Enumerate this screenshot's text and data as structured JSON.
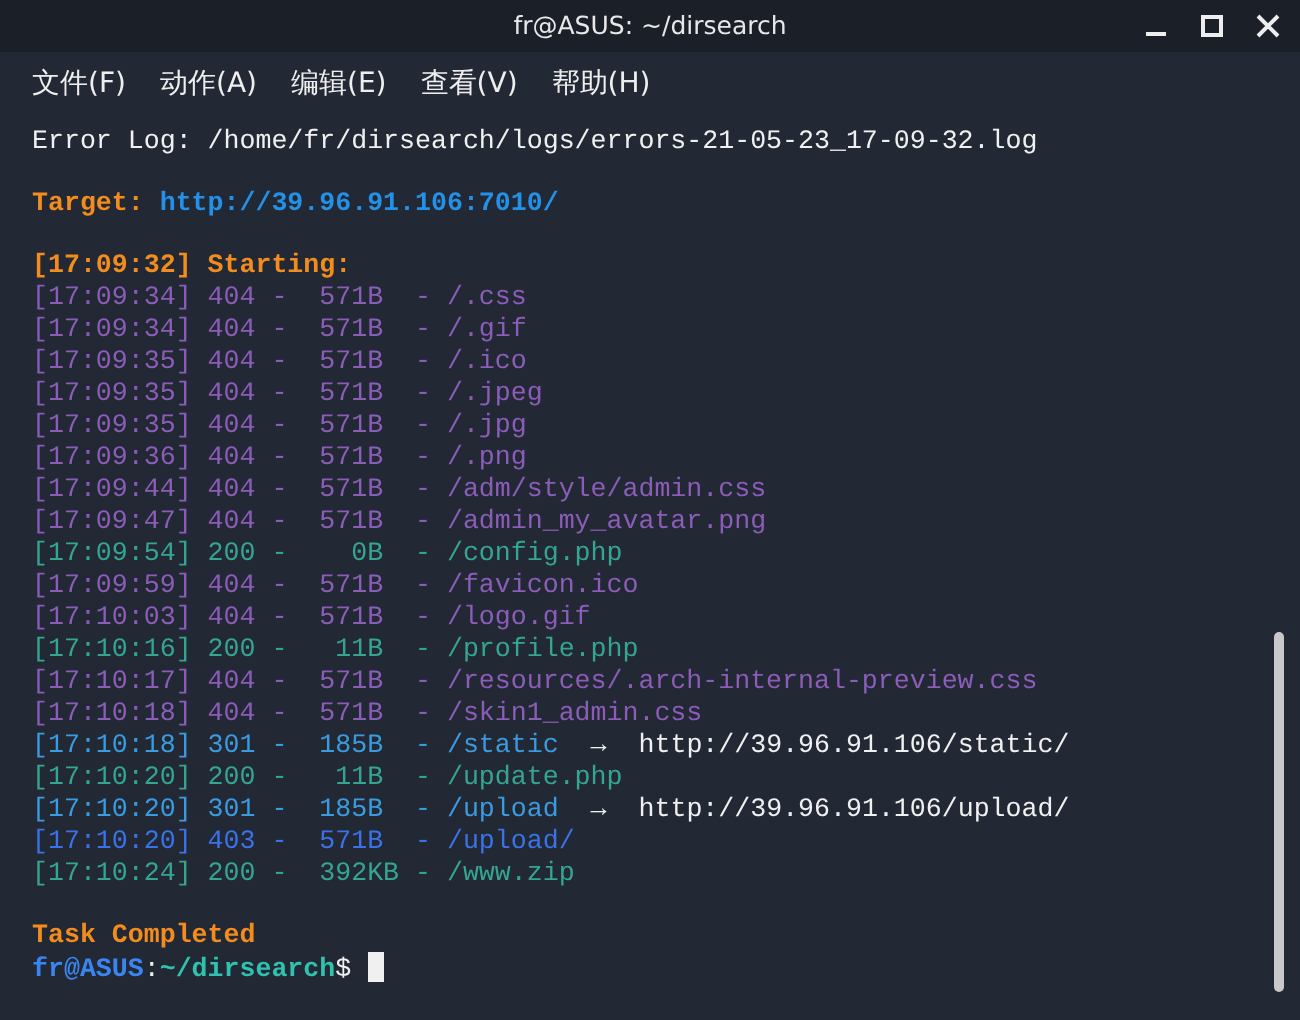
{
  "window": {
    "title": "fr@ASUS: ~/dirsearch"
  },
  "menu": [
    "文件(F)",
    "动作(A)",
    "编辑(E)",
    "查看(V)",
    "帮助(H)"
  ],
  "terminal": {
    "error_log": "Error Log: /home/fr/dirsearch/logs/errors-21-05-23_17-09-32.log",
    "target": {
      "label": "Target:",
      "url": "http://39.96.91.106:7010/"
    },
    "starting": "[17:09:32] Starting:",
    "rows": [
      {
        "text": "[17:09:34] 404 -  571B  - /.css",
        "color": "#8b5cb8"
      },
      {
        "text": "[17:09:34] 404 -  571B  - /.gif",
        "color": "#8b5cb8"
      },
      {
        "text": "[17:09:35] 404 -  571B  - /.ico",
        "color": "#8b5cb8"
      },
      {
        "text": "[17:09:35] 404 -  571B  - /.jpeg",
        "color": "#8b5cb8"
      },
      {
        "text": "[17:09:35] 404 -  571B  - /.jpg",
        "color": "#8b5cb8"
      },
      {
        "text": "[17:09:36] 404 -  571B  - /.png",
        "color": "#8b5cb8"
      },
      {
        "text": "[17:09:44] 404 -  571B  - /adm/style/admin.css",
        "color": "#8b5cb8"
      },
      {
        "text": "[17:09:47] 404 -  571B  - /admin_my_avatar.png",
        "color": "#8b5cb8"
      },
      {
        "text": "[17:09:54] 200 -    0B  - /config.php",
        "color": "#35a592"
      },
      {
        "text": "[17:09:59] 404 -  571B  - /favicon.ico",
        "color": "#8b5cb8"
      },
      {
        "text": "[17:10:03] 404 -  571B  - /logo.gif",
        "color": "#8b5cb8"
      },
      {
        "text": "[17:10:16] 200 -   11B  - /profile.php",
        "color": "#35a592"
      },
      {
        "text": "[17:10:17] 404 -  571B  - /resources/.arch-internal-preview.css",
        "color": "#8b5cb8"
      },
      {
        "text": "[17:10:18] 404 -  571B  - /skin1_admin.css",
        "color": "#8b5cb8"
      },
      {
        "text": "[17:10:18] 301 -  185B  - /static",
        "color": "#3a9be0",
        "arrow": "→",
        "redirect": "http://39.96.91.106/static/"
      },
      {
        "text": "[17:10:20] 200 -   11B  - /update.php",
        "color": "#35a592"
      },
      {
        "text": "[17:10:20] 301 -  185B  - /upload",
        "color": "#3a9be0",
        "arrow": "→",
        "redirect": "http://39.96.91.106/upload/"
      },
      {
        "text": "[17:10:20] 403 -  571B  - /upload/",
        "color": "#3a72e8"
      },
      {
        "text": "[17:10:24] 200 -  392KB - /www.zip",
        "color": "#35a592"
      }
    ],
    "completed": "Task Completed",
    "prompt": {
      "user": "fr@ASUS",
      "sep": ":",
      "path": "~/dirsearch",
      "symbol": "$"
    }
  }
}
